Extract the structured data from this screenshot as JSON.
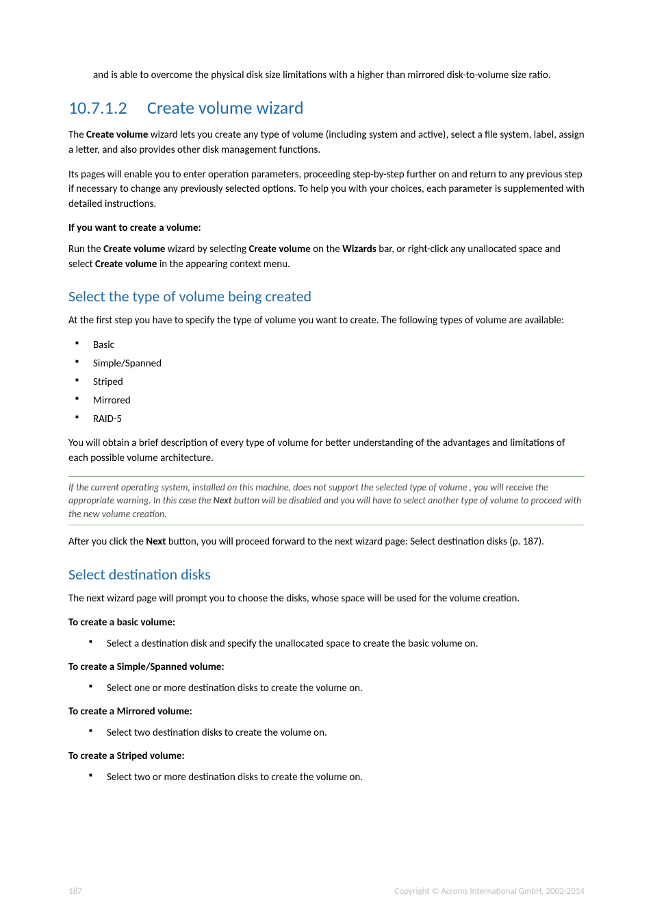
{
  "intro_para": "and is able to overcome the physical disk size limitations with a higher than mirrored disk-to-volume size ratio.",
  "section": {
    "number": "10.7.1.2",
    "title": "Create volume wizard"
  },
  "p1_a": "The ",
  "p1_b": "Create volume",
  "p1_c": " wizard lets you create any type of volume (including system and active), select a file system, label, assign a letter, and also provides other disk management functions.",
  "p2": "Its pages will enable you to enter operation parameters, proceeding step-by-step further on and return to any previous step if necessary to change any previously selected options. To help you with your choices, each parameter is supplemented with detailed instructions.",
  "p3_label": "If you want to create a volume",
  "p4_a": "Run the ",
  "p4_b": "Create volume",
  "p4_c": " wizard by selecting ",
  "p4_d": "Create volume",
  "p4_e": " on the ",
  "p4_f": "Wizards",
  "p4_g": " bar, or right-click any unallocated space and select ",
  "p4_h": "Create volume",
  "p4_i": " in the appearing context menu.",
  "h_select_type": "Select the type of volume being created",
  "p5": "At the first step you have to specify the type of volume you want to create. The following types of volume are available:",
  "vol_types": [
    "Basic",
    "Simple/Spanned",
    "Striped",
    "Mirrored",
    "RAID-5"
  ],
  "p6": "You will obtain a brief description of every type of volume for better understanding of the advantages and limitations of each possible volume architecture.",
  "note_a": "If the current operating system, installed on this machine, does not support the selected type of volume , you will receive the appropriate warning. In this case the ",
  "note_b": "Next",
  "note_c": " button will be disabled and you will have to select another type of volume to proceed with the new volume creation.",
  "p7_a": "After you click the ",
  "p7_b": "Next",
  "p7_c": " button, you will proceed forward to the next wizard page: Select destination disks (p. 187).",
  "h_select_dest": "Select destination disks",
  "p8": "The next wizard page will prompt you to choose the disks, whose space will be used for the volume creation.",
  "create_basic_label": "To create a basic volume:",
  "create_basic_item": "Select a destination disk and specify the unallocated space to create the basic volume on.",
  "create_spanned_label": "To create a Simple/Spanned volume:",
  "create_spanned_item": "Select one or more destination disks to create the volume on.",
  "create_mirrored_label": "To create a Mirrored volume:",
  "create_mirrored_item": "Select two destination disks to create the volume on.",
  "create_striped_label": "To create a Striped volume:",
  "create_striped_item": "Select two or more destination disks to create the volume on.",
  "footer": {
    "page_num": "187",
    "copyright": "Copyright © Acronis International GmbH, 2002-2014"
  }
}
